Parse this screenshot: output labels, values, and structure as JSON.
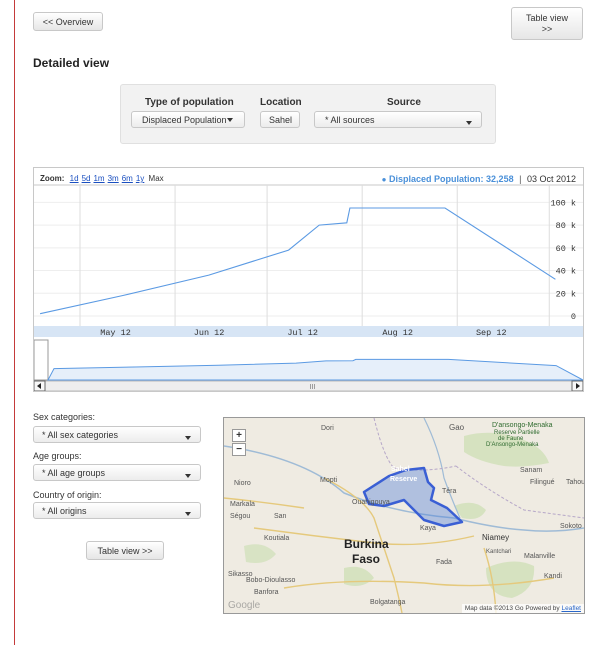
{
  "nav": {
    "overview_label": "<< Overview",
    "table_view_top_label": "Table view >>"
  },
  "page_title": "Detailed view",
  "filters": {
    "type_of_population": {
      "label": "Type of population",
      "value": "Displaced Population"
    },
    "location": {
      "label": "Location",
      "value": "Sahel"
    },
    "source": {
      "label": "Source",
      "value": "* All sources"
    }
  },
  "chart_data": {
    "type": "line",
    "zoom": {
      "label": "Zoom:",
      "options": [
        "1d",
        "5d",
        "1m",
        "3m",
        "6m",
        "1y"
      ],
      "current": "Max"
    },
    "tooltip": {
      "series_label": "Displaced Population:",
      "value": "32,258",
      "date": "03 Oct 2012"
    },
    "y_ticks": [
      "100 k",
      "80 k",
      "60 k",
      "40 k",
      "20 k",
      "0"
    ],
    "x_ticks": [
      "May 12",
      "Jun 12",
      "Jul 12",
      "Aug 12",
      "Sep 12"
    ],
    "ylim": [
      0,
      110000
    ],
    "series": [
      {
        "values": [
          {
            "x": "2012-04-18",
            "y": 2000
          },
          {
            "x": "2012-05-15",
            "y": 18000
          },
          {
            "x": "2012-06-12",
            "y": 36000
          },
          {
            "x": "2012-07-08",
            "y": 58000
          },
          {
            "x": "2012-07-18",
            "y": 80000
          },
          {
            "x": "2012-07-27",
            "y": 82000
          },
          {
            "x": "2012-07-28",
            "y": 95000
          },
          {
            "x": "2012-08-28",
            "y": 95000
          },
          {
            "x": "2012-10-03",
            "y": 32258
          }
        ]
      }
    ],
    "navigator": {
      "scroll_center_mark": "III"
    }
  },
  "side_filters": {
    "sex": {
      "label": "Sex categories:",
      "value": "* All sex categories"
    },
    "age": {
      "label": "Age groups:",
      "value": "* All age groups"
    },
    "origin": {
      "label": "Country of origin:",
      "value": "* All origins"
    }
  },
  "table_view_bottom_label": "Table view >>",
  "map": {
    "zoom_in": "+",
    "zoom_out": "−",
    "places": [
      "Gao",
      "D'ansongo-Menaka",
      "Reserve Partielle",
      "de Faune",
      "D'Ansongo-Menaka",
      "Dori",
      "Mopti",
      "Sahel",
      "Reserve",
      "Sanam",
      "Filingué",
      "Tahoua",
      "Nioro",
      "Ouahigouya",
      "Téra",
      "Markala",
      "Ségou",
      "San",
      "Niamey",
      "Sokoto",
      "Kaya",
      "Kantchari",
      "Koutiala",
      "Fada",
      "Burkina",
      "Faso",
      "Sikasso",
      "Bobo-Dioulasso",
      "Kandi",
      "Banfora",
      "Bolgatanga",
      "Malanville"
    ],
    "attribution_data": "Map data ©2013 Go",
    "attribution_powered": "Powered by",
    "attribution_link": "Leaflet",
    "watermark": "Google"
  }
}
